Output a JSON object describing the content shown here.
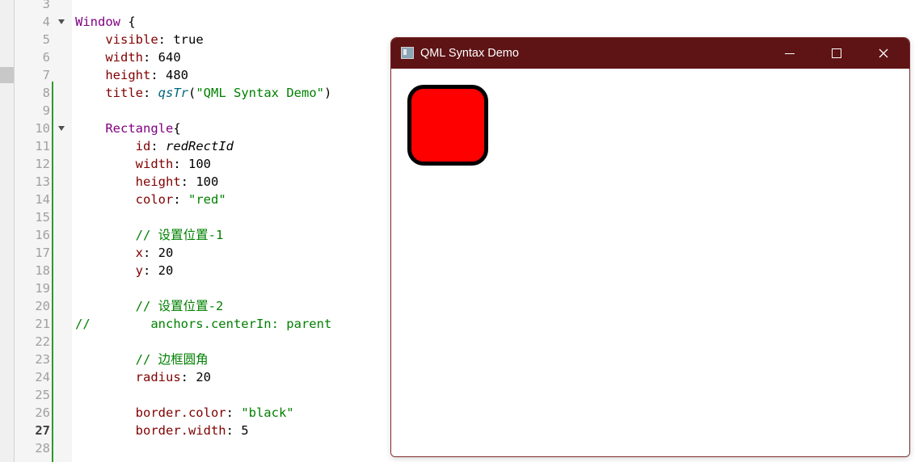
{
  "editor": {
    "lines": [
      {
        "n": "3",
        "segs": [],
        "fold": false
      },
      {
        "n": "4",
        "segs": [
          {
            "t": "Window",
            "c": "kw-type"
          },
          {
            "t": " {",
            "c": ""
          }
        ],
        "fold": true
      },
      {
        "n": "5",
        "segs": [
          {
            "t": "    ",
            "c": ""
          },
          {
            "t": "visible",
            "c": "prop"
          },
          {
            "t": ": true",
            "c": ""
          }
        ],
        "fold": false
      },
      {
        "n": "6",
        "segs": [
          {
            "t": "    ",
            "c": ""
          },
          {
            "t": "width",
            "c": "prop"
          },
          {
            "t": ": 640",
            "c": ""
          }
        ],
        "fold": false
      },
      {
        "n": "7",
        "segs": [
          {
            "t": "    ",
            "c": ""
          },
          {
            "t": "height",
            "c": "prop"
          },
          {
            "t": ": 480",
            "c": ""
          }
        ],
        "fold": false
      },
      {
        "n": "8",
        "segs": [
          {
            "t": "    ",
            "c": ""
          },
          {
            "t": "title",
            "c": "prop"
          },
          {
            "t": ": ",
            "c": ""
          },
          {
            "t": "qsTr",
            "c": "func"
          },
          {
            "t": "(",
            "c": ""
          },
          {
            "t": "\"QML Syntax Demo\"",
            "c": "str"
          },
          {
            "t": ")",
            "c": ""
          }
        ],
        "fold": false
      },
      {
        "n": "9",
        "segs": [],
        "fold": false
      },
      {
        "n": "10",
        "segs": [
          {
            "t": "    ",
            "c": ""
          },
          {
            "t": "Rectangle",
            "c": "kw-type"
          },
          {
            "t": "{",
            "c": ""
          }
        ],
        "fold": true
      },
      {
        "n": "11",
        "segs": [
          {
            "t": "        ",
            "c": ""
          },
          {
            "t": "id",
            "c": "prop"
          },
          {
            "t": ": ",
            "c": ""
          },
          {
            "t": "redRectId",
            "c": "ident"
          }
        ],
        "fold": false
      },
      {
        "n": "12",
        "segs": [
          {
            "t": "        ",
            "c": ""
          },
          {
            "t": "width",
            "c": "prop"
          },
          {
            "t": ": 100",
            "c": ""
          }
        ],
        "fold": false
      },
      {
        "n": "13",
        "segs": [
          {
            "t": "        ",
            "c": ""
          },
          {
            "t": "height",
            "c": "prop"
          },
          {
            "t": ": 100",
            "c": ""
          }
        ],
        "fold": false
      },
      {
        "n": "14",
        "segs": [
          {
            "t": "        ",
            "c": ""
          },
          {
            "t": "color",
            "c": "prop"
          },
          {
            "t": ": ",
            "c": ""
          },
          {
            "t": "\"red\"",
            "c": "str"
          }
        ],
        "fold": false
      },
      {
        "n": "15",
        "segs": [],
        "fold": false
      },
      {
        "n": "16",
        "segs": [
          {
            "t": "        ",
            "c": ""
          },
          {
            "t": "// ",
            "c": "cmt"
          },
          {
            "t": "设置位置",
            "c": "cmt cjk"
          },
          {
            "t": "-1",
            "c": "cmt"
          }
        ],
        "fold": false
      },
      {
        "n": "17",
        "segs": [
          {
            "t": "        ",
            "c": ""
          },
          {
            "t": "x",
            "c": "prop"
          },
          {
            "t": ": 20",
            "c": ""
          }
        ],
        "fold": false
      },
      {
        "n": "18",
        "segs": [
          {
            "t": "        ",
            "c": ""
          },
          {
            "t": "y",
            "c": "prop"
          },
          {
            "t": ": 20",
            "c": ""
          }
        ],
        "fold": false
      },
      {
        "n": "19",
        "segs": [],
        "fold": false
      },
      {
        "n": "20",
        "segs": [
          {
            "t": "        ",
            "c": ""
          },
          {
            "t": "// ",
            "c": "cmt"
          },
          {
            "t": "设置位置",
            "c": "cmt cjk"
          },
          {
            "t": "-2",
            "c": "cmt"
          }
        ],
        "fold": false
      },
      {
        "n": "21",
        "segs": [
          {
            "t": "//        anchors.centerIn: parent",
            "c": "cmt"
          }
        ],
        "fold": false
      },
      {
        "n": "22",
        "segs": [],
        "fold": false
      },
      {
        "n": "23",
        "segs": [
          {
            "t": "        ",
            "c": ""
          },
          {
            "t": "// ",
            "c": "cmt"
          },
          {
            "t": "边框圆角",
            "c": "cmt cjk"
          }
        ],
        "fold": false
      },
      {
        "n": "24",
        "segs": [
          {
            "t": "        ",
            "c": ""
          },
          {
            "t": "radius",
            "c": "prop"
          },
          {
            "t": ": 20",
            "c": ""
          }
        ],
        "fold": false
      },
      {
        "n": "25",
        "segs": [],
        "fold": false
      },
      {
        "n": "26",
        "segs": [
          {
            "t": "        ",
            "c": ""
          },
          {
            "t": "border.color",
            "c": "prop"
          },
          {
            "t": ": ",
            "c": ""
          },
          {
            "t": "\"black\"",
            "c": "str"
          }
        ],
        "fold": false
      },
      {
        "n": "27",
        "segs": [
          {
            "t": "        ",
            "c": ""
          },
          {
            "t": "border.width",
            "c": "prop"
          },
          {
            "t": ": 5",
            "c": ""
          }
        ],
        "fold": false,
        "current": true
      },
      {
        "n": "28",
        "segs": [],
        "fold": false
      }
    ]
  },
  "window": {
    "title": "QML Syntax Demo",
    "titlebar_color": "#5e1315",
    "rect_color": "#ff0000",
    "rect_border_color": "#000000"
  }
}
